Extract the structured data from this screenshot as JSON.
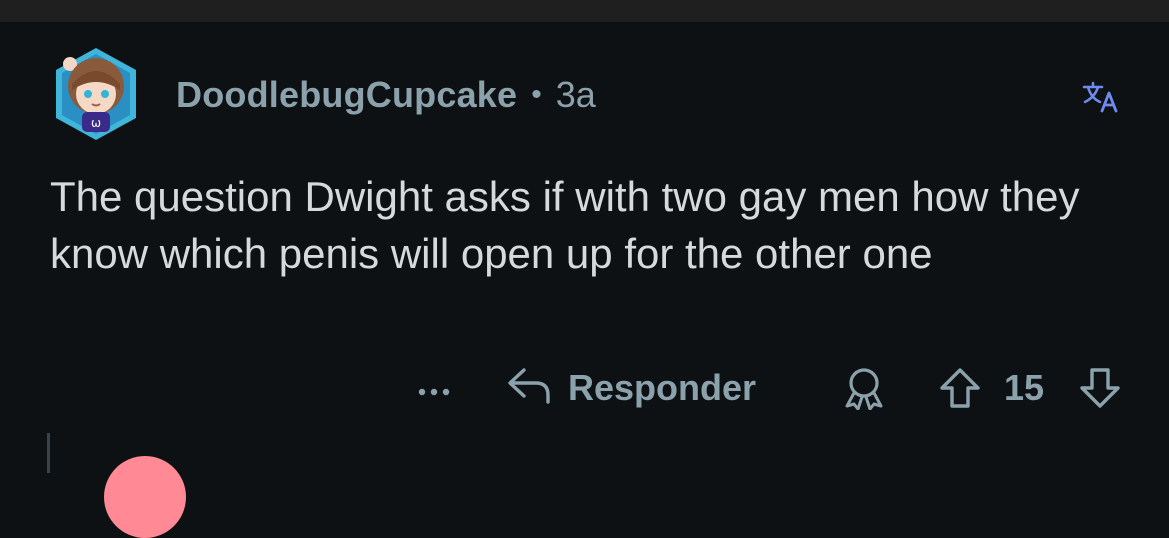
{
  "comment": {
    "username": "DoodlebugCupcake",
    "separator": "•",
    "time": "3a",
    "body": "The question Dwight asks if with two gay men how they know which penis will open up for the other one"
  },
  "actions": {
    "more_label": "•••",
    "reply_label": "Responder",
    "score": "15"
  },
  "icons": {
    "translate": "translate-icon",
    "reply": "reply-arrow-icon",
    "award": "award-icon",
    "upvote": "upvote-arrow-icon",
    "downvote": "downvote-arrow-icon"
  },
  "colors": {
    "background": "#0e1113",
    "meta_text": "#8ba2ad",
    "body_text": "#d7dadc",
    "translate_accent": "#6e8bf0",
    "next_avatar": "#ff8a95"
  }
}
